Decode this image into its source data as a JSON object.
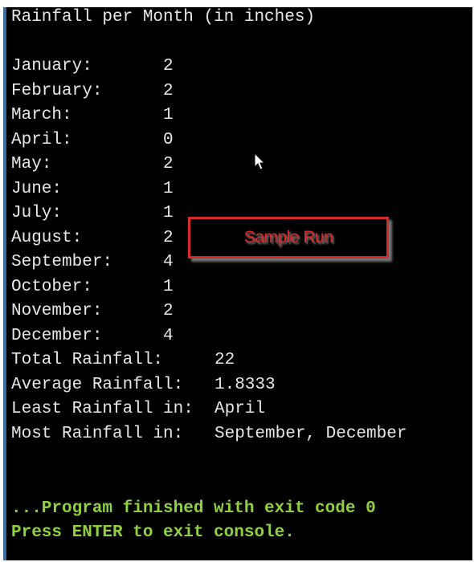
{
  "title": "Rainfall per Month (in inches)",
  "months": [
    {
      "label": "January:",
      "value": "2"
    },
    {
      "label": "February:",
      "value": "2"
    },
    {
      "label": "March:",
      "value": "1"
    },
    {
      "label": "April:",
      "value": "0"
    },
    {
      "label": "May:",
      "value": "2"
    },
    {
      "label": "June:",
      "value": "1"
    },
    {
      "label": "July:",
      "value": "1"
    },
    {
      "label": "August:",
      "value": "2"
    },
    {
      "label": "September:",
      "value": "4"
    },
    {
      "label": "October:",
      "value": "1"
    },
    {
      "label": "November:",
      "value": "2"
    },
    {
      "label": "December:",
      "value": "4"
    }
  ],
  "summary": [
    {
      "label": "Total Rainfall:",
      "value": "22"
    },
    {
      "label": "Average Rainfall:",
      "value": "1.8333"
    },
    {
      "label": "Least Rainfall in:",
      "value": "April"
    },
    {
      "label": "Most Rainfall in:",
      "value": "September, December"
    }
  ],
  "exit_message": "...Program finished with exit code 0",
  "prompt_message": "Press ENTER to exit console.",
  "badge_label": "Sample Run",
  "colors": {
    "background": "#000000",
    "text": "#e8e8e8",
    "exit_text": "#8fd13f",
    "badge": "#d42a2a",
    "border": "#3a6ea5"
  }
}
